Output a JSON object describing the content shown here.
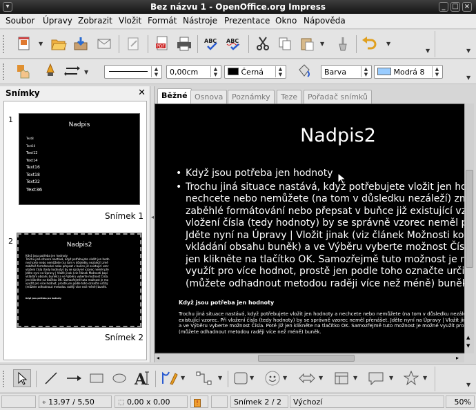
{
  "window": {
    "title": "Bez názvu 1 - OpenOffice.org Impress"
  },
  "menu": [
    "Soubor",
    "Úpravy",
    "Zobrazit",
    "Vložit",
    "Formát",
    "Nástroje",
    "Prezentace",
    "Okno",
    "Nápověda"
  ],
  "line_toolbar": {
    "line_width": "0,00cm",
    "line_color": "Černá",
    "fill_type": "Barva",
    "fill_color": "Modrá 8",
    "line_color_hex": "#000000",
    "fill_color_hex": "#99ccff"
  },
  "slides_panel": {
    "title": "Snímky",
    "slides": [
      {
        "number": "1",
        "label": "Snímek 1",
        "title": "Nadpis",
        "items": [
          "Text8",
          "Text10",
          "Text12",
          "Text14",
          "Text16",
          "Text18",
          "Text32",
          "Text36"
        ]
      },
      {
        "number": "2",
        "label": "Snímek 2",
        "title": "Nadpis2"
      }
    ]
  },
  "view_tabs": [
    "Běžné",
    "Osnova",
    "Poznámky",
    "Teze",
    "Pořadač snímků"
  ],
  "slide": {
    "title": "Nadpis2",
    "bullets": [
      "Když jsou potřeba jen hodnoty",
      "Trochu jiná situace nastává, když potřebujete vložit jen hodn\nnechcete nebo nemůžete (na tom v důsledku nezáleží) změ\nzaběhlé formátování nebo přepsat v buňce již existující vzor\nvložení čísla (tedy hodnoty) by se správně vzorec neměl pře\nJděte nyní na Úpravy | Vložit jinak (viz článek Možnosti kopí\nvkládání obsahu buněk) a ve Výběru vyberte možnost Čísla.\njen klikněte na tlačítko OK. Samozřejmě tuto možnost je mo\nvyužít pro více hodnot, prostě jen podle toho označte určitý\n(můžete odhadnout metodou raději více než méně) buněk."
    ],
    "notes_title": "Když jsou potřeba jen hodnoty",
    "notes_body": "Trochu jiná situace nastává, když potřebujete vložit jen hodnoty a nechcete nebo nemůžete (na tom v důsledku nezáleží) změnit zaběhlé for\nexistující vzorec. Při vložení čísla (tedy hodnoty) by se správně vzorec neměl přenášet. Jděte nyní na Úpravy | Vložit jinak (viz článek\na ve Výběru vyberte možnost Čísla. Poté již jen klikněte na tlačítko OK. Samozřejmě tuto možnost je možné využít pro více hodnot, prostě j\n(můžete odhadnout metodou raději více než méně) buněk."
  },
  "status": {
    "position": "13,97 / 5,50",
    "size": "0,00 x 0,00",
    "slide": "Snímek 2 / 2",
    "layout": "Výchozí",
    "zoom": "50%"
  }
}
